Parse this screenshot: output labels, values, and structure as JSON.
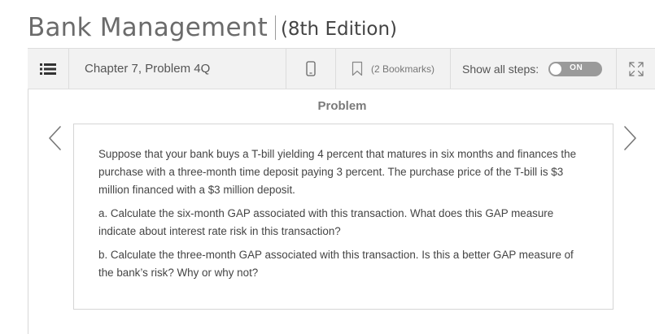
{
  "book": {
    "title": "Bank Management",
    "edition": "(8th Edition)"
  },
  "toolbar": {
    "chapter_label": "Chapter 7, Problem 4Q",
    "bookmarks_label": "(2 Bookmarks)",
    "show_steps_label": "Show all steps:",
    "toggle_state": "ON",
    "icons": {
      "menu": "list-menu-icon",
      "device": "mobile-device-icon",
      "bookmark": "bookmark-icon",
      "expand": "expand-fullscreen-icon"
    }
  },
  "content": {
    "heading": "Problem",
    "paragraphs": [
      "Suppose that your bank buys a T-bill yielding 4 percent that matures in six months and finances the purchase with a three-month time deposit paying 3 percent. The purchase price of the T-bill is $3 million financed with a $3 million deposit.",
      "a. Calculate the six-month GAP associated with this transaction. What does this GAP measure indicate about interest rate risk in this transaction?",
      "b. Calculate the three-month GAP associated with this transaction. Is this a better GAP measure of the bank’s risk? Why or why not?"
    ],
    "icons": {
      "prev": "chevron-left-icon",
      "next": "chevron-right-icon"
    }
  },
  "colors": {
    "toolbar_bg": "#f2f2f2",
    "title_text": "#6b6b6b",
    "toggle_bg": "#9a9a9a",
    "border": "#d5d5d5"
  }
}
